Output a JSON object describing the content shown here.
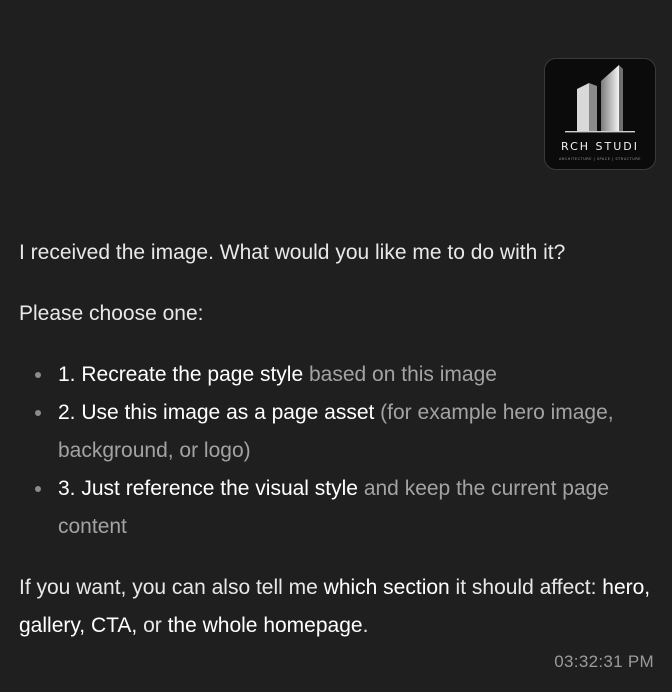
{
  "attachment": {
    "logo_name": "RCH STUDI",
    "logo_tagline": "ARCHITECTURE | SPACE | STRUCTURE"
  },
  "message": {
    "intro": "I received the image. What would you like me to do with it?",
    "prompt": "Please choose one:",
    "options": [
      {
        "strong": "1. Recreate the page style",
        "rest": " based on this image"
      },
      {
        "strong": "2. Use this image as a page asset",
        "rest": " (for example hero image, background, or logo)"
      },
      {
        "strong": "3. Just reference the visual style",
        "rest": " and keep the current page content"
      }
    ],
    "closing": {
      "part1": "If you want, you can also tell me ",
      "bold1": "which section",
      "part2": " it should affect: ",
      "bold2": "hero, gallery, CTA,",
      "part3": " or ",
      "bold3": "the whole homepage",
      "part4": "."
    }
  },
  "timestamp": "03:32:31 PM"
}
